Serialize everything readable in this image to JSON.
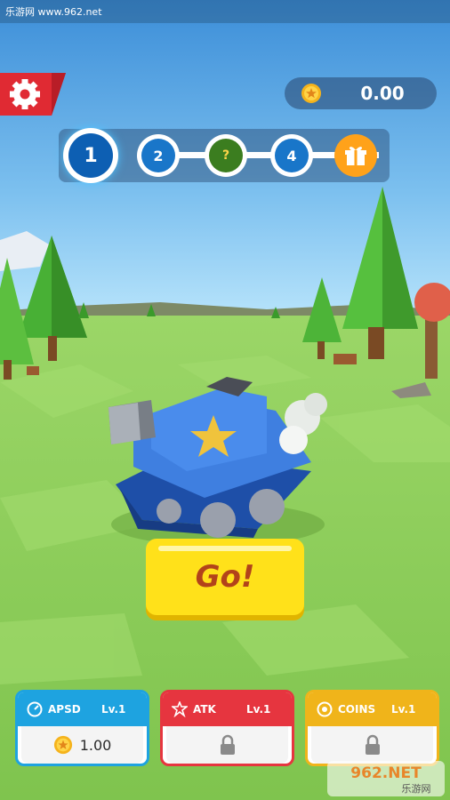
{
  "watermark": {
    "top": "乐游网 www.962.net",
    "bottom_logo": "962.NET",
    "bottom_sub": "乐游网"
  },
  "header": {
    "settings_icon": "gear-icon",
    "coin_icon": "star-coin-icon",
    "coin_balance": "0.00"
  },
  "level_progress": {
    "nodes": [
      {
        "label": "1",
        "state": "current"
      },
      {
        "label": "2",
        "state": "locked"
      },
      {
        "label": "?",
        "state": "mystery"
      },
      {
        "label": "4",
        "state": "locked"
      },
      {
        "label": "",
        "state": "gift",
        "icon": "gift-icon"
      }
    ]
  },
  "go_button": {
    "label": "Go!"
  },
  "upgrades": [
    {
      "name": "APSD",
      "level": "Lv.1",
      "icon": "speed-icon",
      "cost": "1.00",
      "locked": false
    },
    {
      "name": "ATK",
      "level": "Lv.1",
      "icon": "attack-icon",
      "locked": true
    },
    {
      "name": "COINS",
      "level": "Lv.1",
      "icon": "coin-icon",
      "locked": true
    }
  ],
  "colors": {
    "apsd": "#1ea3e0",
    "atk": "#e6353f",
    "coins": "#f0b41a",
    "go": "#ffe11a",
    "settings": "#e02a33"
  }
}
